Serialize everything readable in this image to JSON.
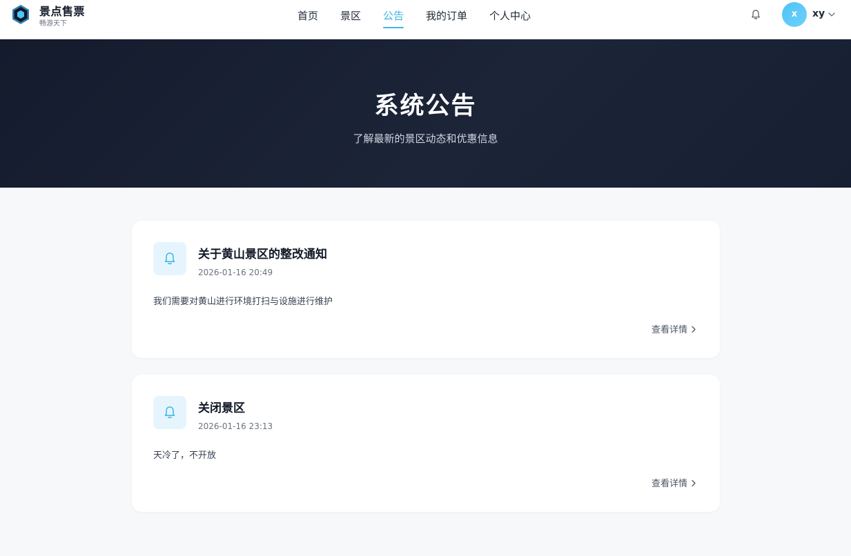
{
  "brand": {
    "name": "景点售票",
    "slogan": "畅游天下",
    "accent_color": "#38b6e8"
  },
  "nav": {
    "items": [
      {
        "label": "首页",
        "active": false
      },
      {
        "label": "景区",
        "active": false
      },
      {
        "label": "公告",
        "active": true
      },
      {
        "label": "我的订单",
        "active": false
      },
      {
        "label": "个人中心",
        "active": false
      }
    ]
  },
  "user": {
    "avatar_initial": "x",
    "name": "xy",
    "notification_icon": "bell-icon",
    "menu_icon": "chevron-down-icon"
  },
  "hero": {
    "title": "系统公告",
    "subtitle": "了解最新的景区动态和优惠信息"
  },
  "announcements": [
    {
      "icon": "bell-icon",
      "title": "关于黄山景区的整改通知",
      "date": "2026-01-16 20:49",
      "content": "我们需要对黄山进行环境打扫与设施进行维护",
      "detail_label": "查看详情"
    },
    {
      "icon": "bell-icon",
      "title": "关闭景区",
      "date": "2026-01-16 23:13",
      "content": "天冷了，不开放",
      "detail_label": "查看详情"
    }
  ]
}
